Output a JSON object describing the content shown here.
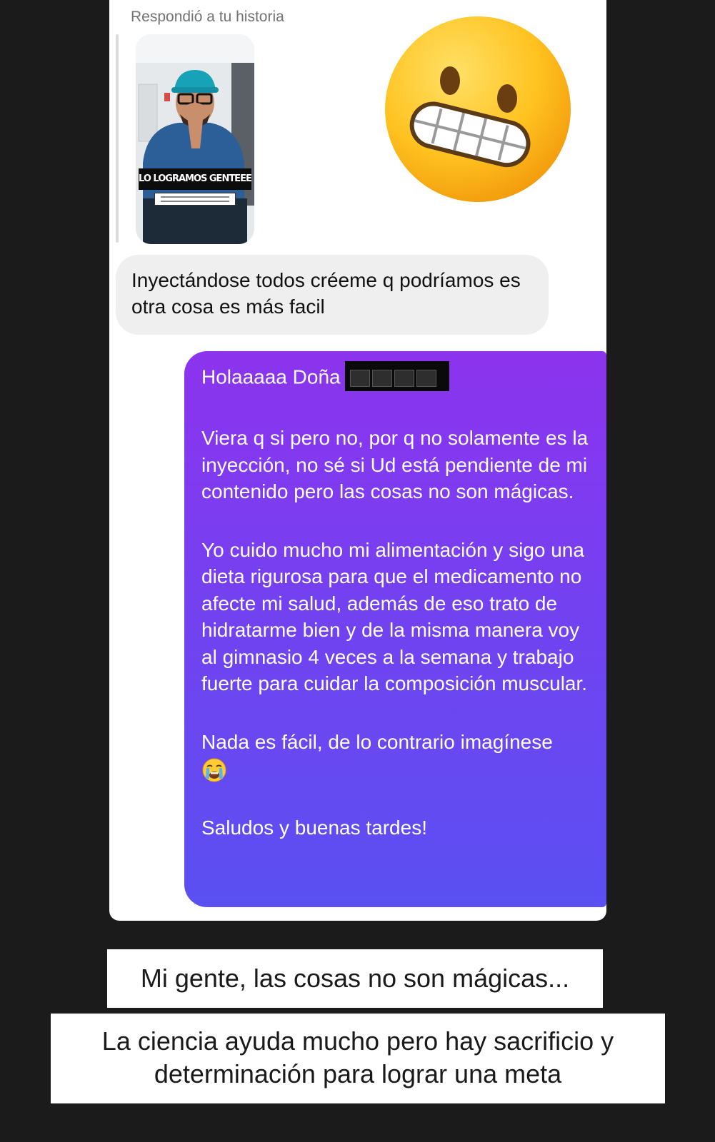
{
  "story_reply": {
    "label": "Respondió a tu historia",
    "story_caption": "LO LOGRAMOS GENTEEEEEEE"
  },
  "reaction": {
    "emoji_name": "grimacing-face-emoji"
  },
  "incoming_message": {
    "text": "Inyectándose todos créeme q podríamos es otra cosa es más facil"
  },
  "outgoing_message": {
    "greeting": "Holaaaaa Doña",
    "paragraph1": "Viera q si pero no, por q no solamente es la inyección, no sé si Ud está pendiente de mi contenido pero las cosas no son mágicas.",
    "paragraph2": "Yo cuido mucho mi alimentación y sigo una dieta rigurosa para que el medicamento no afecte mi salud, además de eso trato de hidratarme bien y de la misma manera voy al gimnasio 4 veces a la semana y trabajo fuerte para cuidar la composición muscular.",
    "paragraph3": "Nada es fácil, de lo contrario imagínese",
    "paragraph4": "Saludos y buenas tardes!",
    "emoji_name": "loudly-crying-face-emoji",
    "gradient_colors": [
      "#8c33ee",
      "#5a50f2"
    ]
  },
  "banners": {
    "line1": "Mi gente, las cosas no son mágicas...",
    "line2": "La ciencia ayuda mucho pero hay sacrificio y determinación para lograr una meta"
  }
}
